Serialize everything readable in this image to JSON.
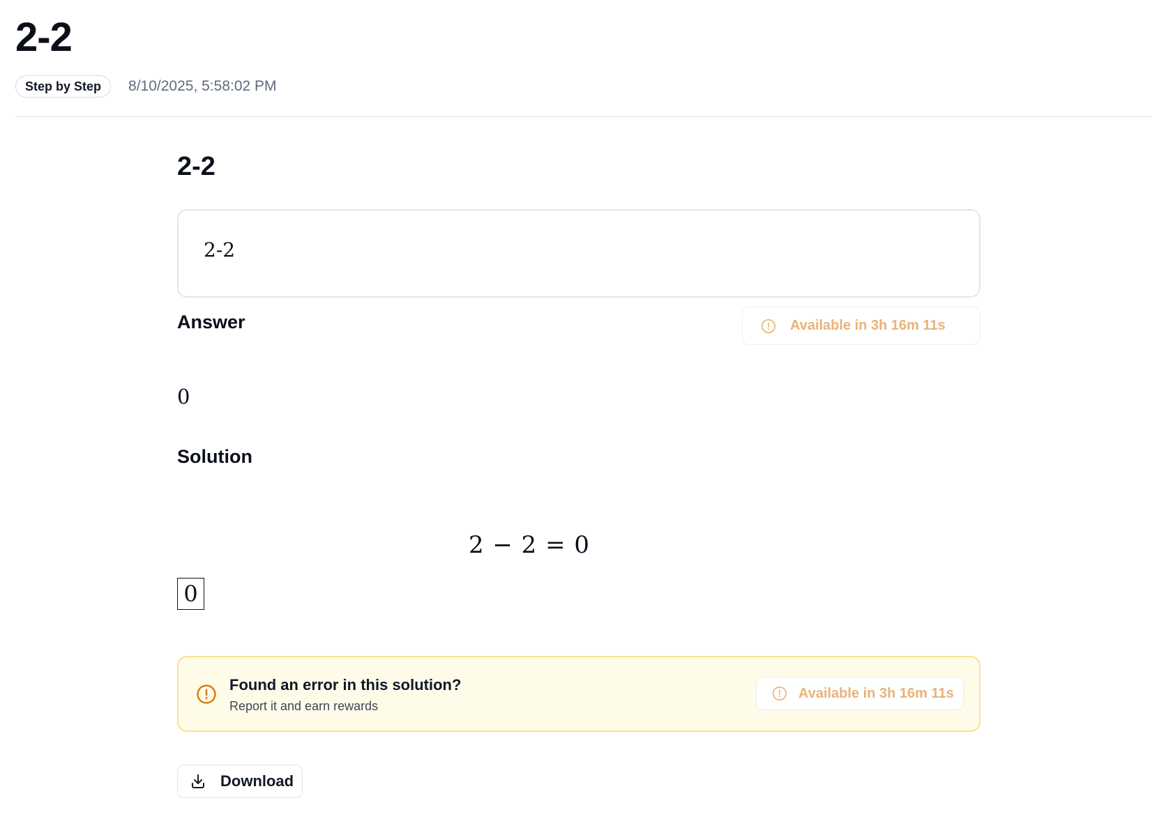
{
  "header": {
    "title": "2-2",
    "mode_badge": "Step by Step",
    "timestamp": "8/10/2025, 5:58:02 PM"
  },
  "problem": {
    "heading": "2-2",
    "expression": "2-2"
  },
  "answer": {
    "title": "Answer",
    "value": "0",
    "availability_label": "Available in 3h 16m 11s",
    "availability_icon": "alert-circle-icon"
  },
  "solution": {
    "title": "Solution",
    "equation": "2 − 2 = 0",
    "boxed_result": "0"
  },
  "report": {
    "title": "Found an error in this solution?",
    "subtitle": "Report it and earn rewards",
    "availability_label": "Available in 3h 16m 11s",
    "icon": "alert-circle-icon"
  },
  "download": {
    "label": "Download",
    "icon": "download-icon"
  },
  "colors": {
    "warning_text": "#eab377",
    "warning_icon": "#d97706",
    "banner_bg": "#fefbe9",
    "banner_border": "#f8e08e",
    "muted_text": "#5d6b80"
  }
}
